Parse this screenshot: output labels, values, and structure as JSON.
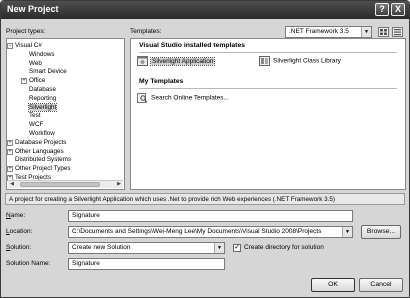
{
  "window": {
    "title": "New Project",
    "help_button": "?",
    "close_button": "X"
  },
  "project_types": {
    "label": "Project types:",
    "items": [
      {
        "label": "Visual C#",
        "expander": "−"
      },
      {
        "label": "Windows"
      },
      {
        "label": "Web"
      },
      {
        "label": "Smart Device"
      },
      {
        "label": "Office",
        "expander": "+"
      },
      {
        "label": "Database"
      },
      {
        "label": "Reporting"
      },
      {
        "label": "Silverlight"
      },
      {
        "label": "Test"
      },
      {
        "label": "WCF"
      },
      {
        "label": "Workflow"
      },
      {
        "label": "Database Projects",
        "expander": "+"
      },
      {
        "label": "Other Languages",
        "expander": "+"
      },
      {
        "label": "Distributed Systems"
      },
      {
        "label": "Other Project Types",
        "expander": "+"
      },
      {
        "label": "Test Projects",
        "expander": "+"
      }
    ],
    "selected": "Silverlight"
  },
  "templates": {
    "label": "Templates:",
    "framework": ".NET Framework 3.5",
    "installed_heading": "Visual Studio installed templates",
    "installed": [
      {
        "label": "Silverlight Application",
        "icon": "silverlight-app-icon"
      },
      {
        "label": "Silverlight Class Library",
        "icon": "silverlight-library-icon"
      }
    ],
    "my_heading": "My Templates",
    "my": [
      {
        "label": "Search Online Templates...",
        "icon": "search-online-icon"
      }
    ]
  },
  "description": "A project for creating a Silverlight Application which uses .Net to provide rich Web experiences (.NET Framework 3.5)",
  "form": {
    "name_label": "Name:",
    "name_value": "Signature",
    "location_label": "Location:",
    "location_value": "C:\\Documents and Settings\\Wei-Meng Lee\\My Documents\\Visual Studio 2008\\Projects",
    "browse_label": "Browse...",
    "solution_label": "Solution:",
    "solution_value": "Create new Solution",
    "create_dir_label": "Create directory for solution",
    "create_dir_checked": true,
    "solution_name_label": "Solution Name:",
    "solution_name_value": "Signature"
  },
  "buttons": {
    "ok": "OK",
    "cancel": "Cancel"
  },
  "colors": {
    "titlebar": "#3a3a3a",
    "dialog_bg": "#d6d6d6",
    "selection": "#d0d0d0"
  }
}
